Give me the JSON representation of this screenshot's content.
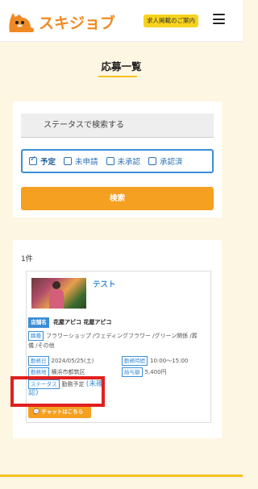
{
  "header": {
    "logo_text": "スキジョブ",
    "recruit_label": "求人掲載のご案内"
  },
  "page": {
    "title": "応募一覧"
  },
  "search": {
    "placeholder": "ステータスで検索する",
    "statuses": [
      {
        "label": "予定",
        "checked": true
      },
      {
        "label": "未申請",
        "checked": false
      },
      {
        "label": "未承認",
        "checked": false
      },
      {
        "label": "承認済",
        "checked": false
      }
    ],
    "button_label": "検索"
  },
  "results": {
    "count": "1件",
    "card": {
      "title": "テスト",
      "shop_badge": "店舗名",
      "shop_name": "花屋アピコ 花屋アピコ",
      "occupation_tag": "職種",
      "occupation_value": "フラワーショップ /ウェディングフラワー /グリーン関係 /葬",
      "occupation_value2": "儀 /その他",
      "date_tag": "勤務日",
      "date_value": "2024/05/25(土)",
      "time_tag": "勤務時間",
      "time_value": "10:00～15:00",
      "area_tag": "勤務地",
      "area_value": "横浜市都筑区",
      "wage_tag": "給与額",
      "wage_value": "5,400円",
      "status_tag": "ステータス",
      "status_value": "勤務予定",
      "status_note_1": "(未確",
      "status_note_2": "認)",
      "chat_label": "チャットはこちら"
    }
  },
  "colors": {
    "accent": "#f5a021",
    "link": "#3b8ed6",
    "highlight": "#e0201f",
    "background": "#fdf6e3"
  }
}
